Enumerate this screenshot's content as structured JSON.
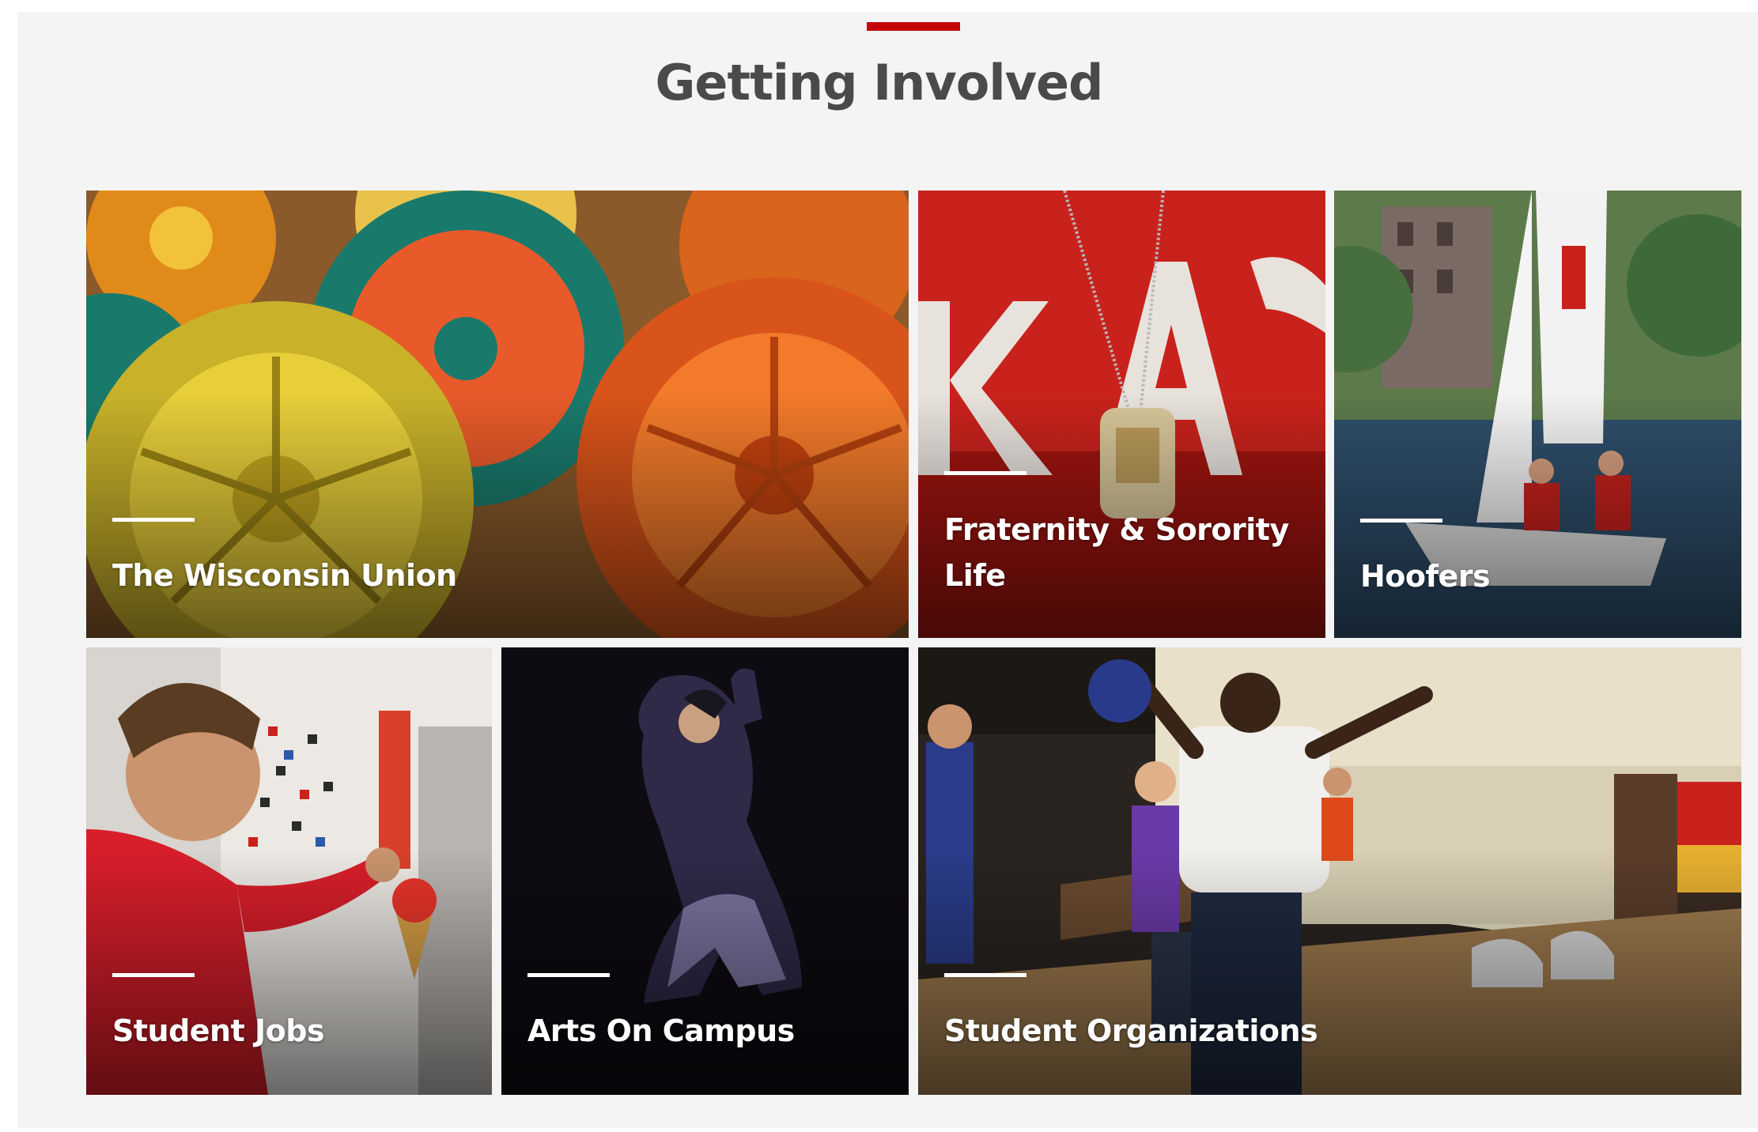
{
  "section": {
    "title": "Getting Involved",
    "accent_color": "#c5050c"
  },
  "tiles": [
    {
      "label": "The Wisconsin Union"
    },
    {
      "label": "Fraternity & Sorority Life"
    },
    {
      "label": "Hoofers"
    },
    {
      "label": "Student Jobs"
    },
    {
      "label": "Arts On Campus"
    },
    {
      "label": "Student Organizations"
    }
  ]
}
